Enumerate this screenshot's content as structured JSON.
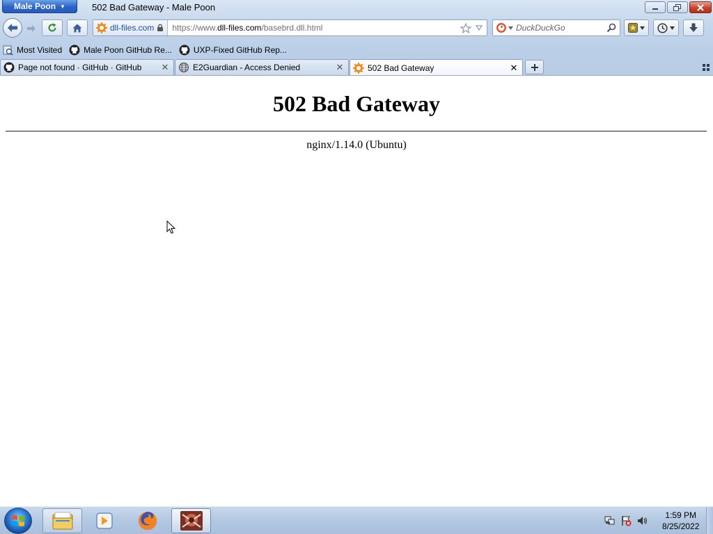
{
  "window": {
    "app_button_label": "Male Poon",
    "title": "502 Bad Gateway - Male Poon"
  },
  "navbar": {
    "identity_host": "dll-files.com",
    "url_prefix": "https://www.",
    "url_domain": "dll-files.com",
    "url_path": "/basebrd.dll.html",
    "search_placeholder": "DuckDuckGo"
  },
  "bookmarks": [
    {
      "label": "Most Visited",
      "icon": "most-visited-icon"
    },
    {
      "label": "Male Poon GitHub Re...",
      "icon": "github-icon"
    },
    {
      "label": "UXP-Fixed GitHub Rep...",
      "icon": "github-icon"
    }
  ],
  "tabs": [
    {
      "label": "Page not found · GitHub · GitHub",
      "icon": "github-icon",
      "active": false
    },
    {
      "label": "E2Guardian - Access Denied",
      "icon": "globe-icon",
      "active": false
    },
    {
      "label": "502 Bad Gateway",
      "icon": "dll-files-icon",
      "active": true
    }
  ],
  "page": {
    "heading": "502 Bad Gateway",
    "server": "nginx/1.14.0 (Ubuntu)"
  },
  "taskbar": {
    "time": "1:59 PM",
    "date": "8/25/2022"
  },
  "colors": {
    "chrome_bg": "#c6d8ec",
    "identity_host": "#1f4e9c",
    "close_button": "#c8432c"
  }
}
